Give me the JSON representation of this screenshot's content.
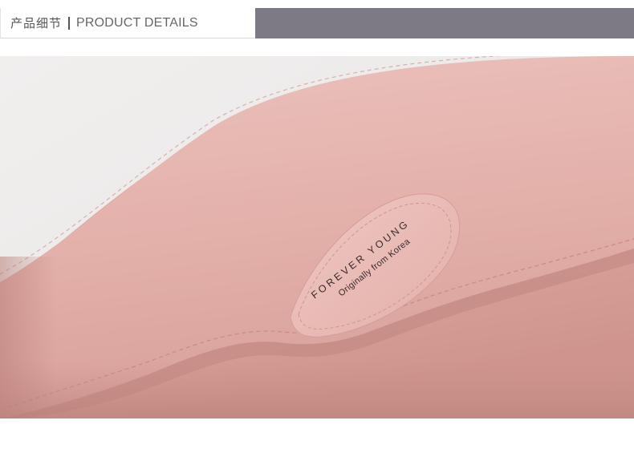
{
  "header": {
    "title_cn": "产品细节",
    "title_en": "PRODUCT DETAILS",
    "bar_color": "#7d7a86"
  },
  "photo": {
    "subject": "pink leather wallet close-up",
    "brand_text": "FOREVER YOUNG",
    "tagline": "Originally from Korea",
    "colors": {
      "leather": "#e3b0ab",
      "leather_dark": "#cf958f",
      "background": "#ecebea",
      "tag": "#e9bab5",
      "print": "#3a2a2c"
    }
  }
}
